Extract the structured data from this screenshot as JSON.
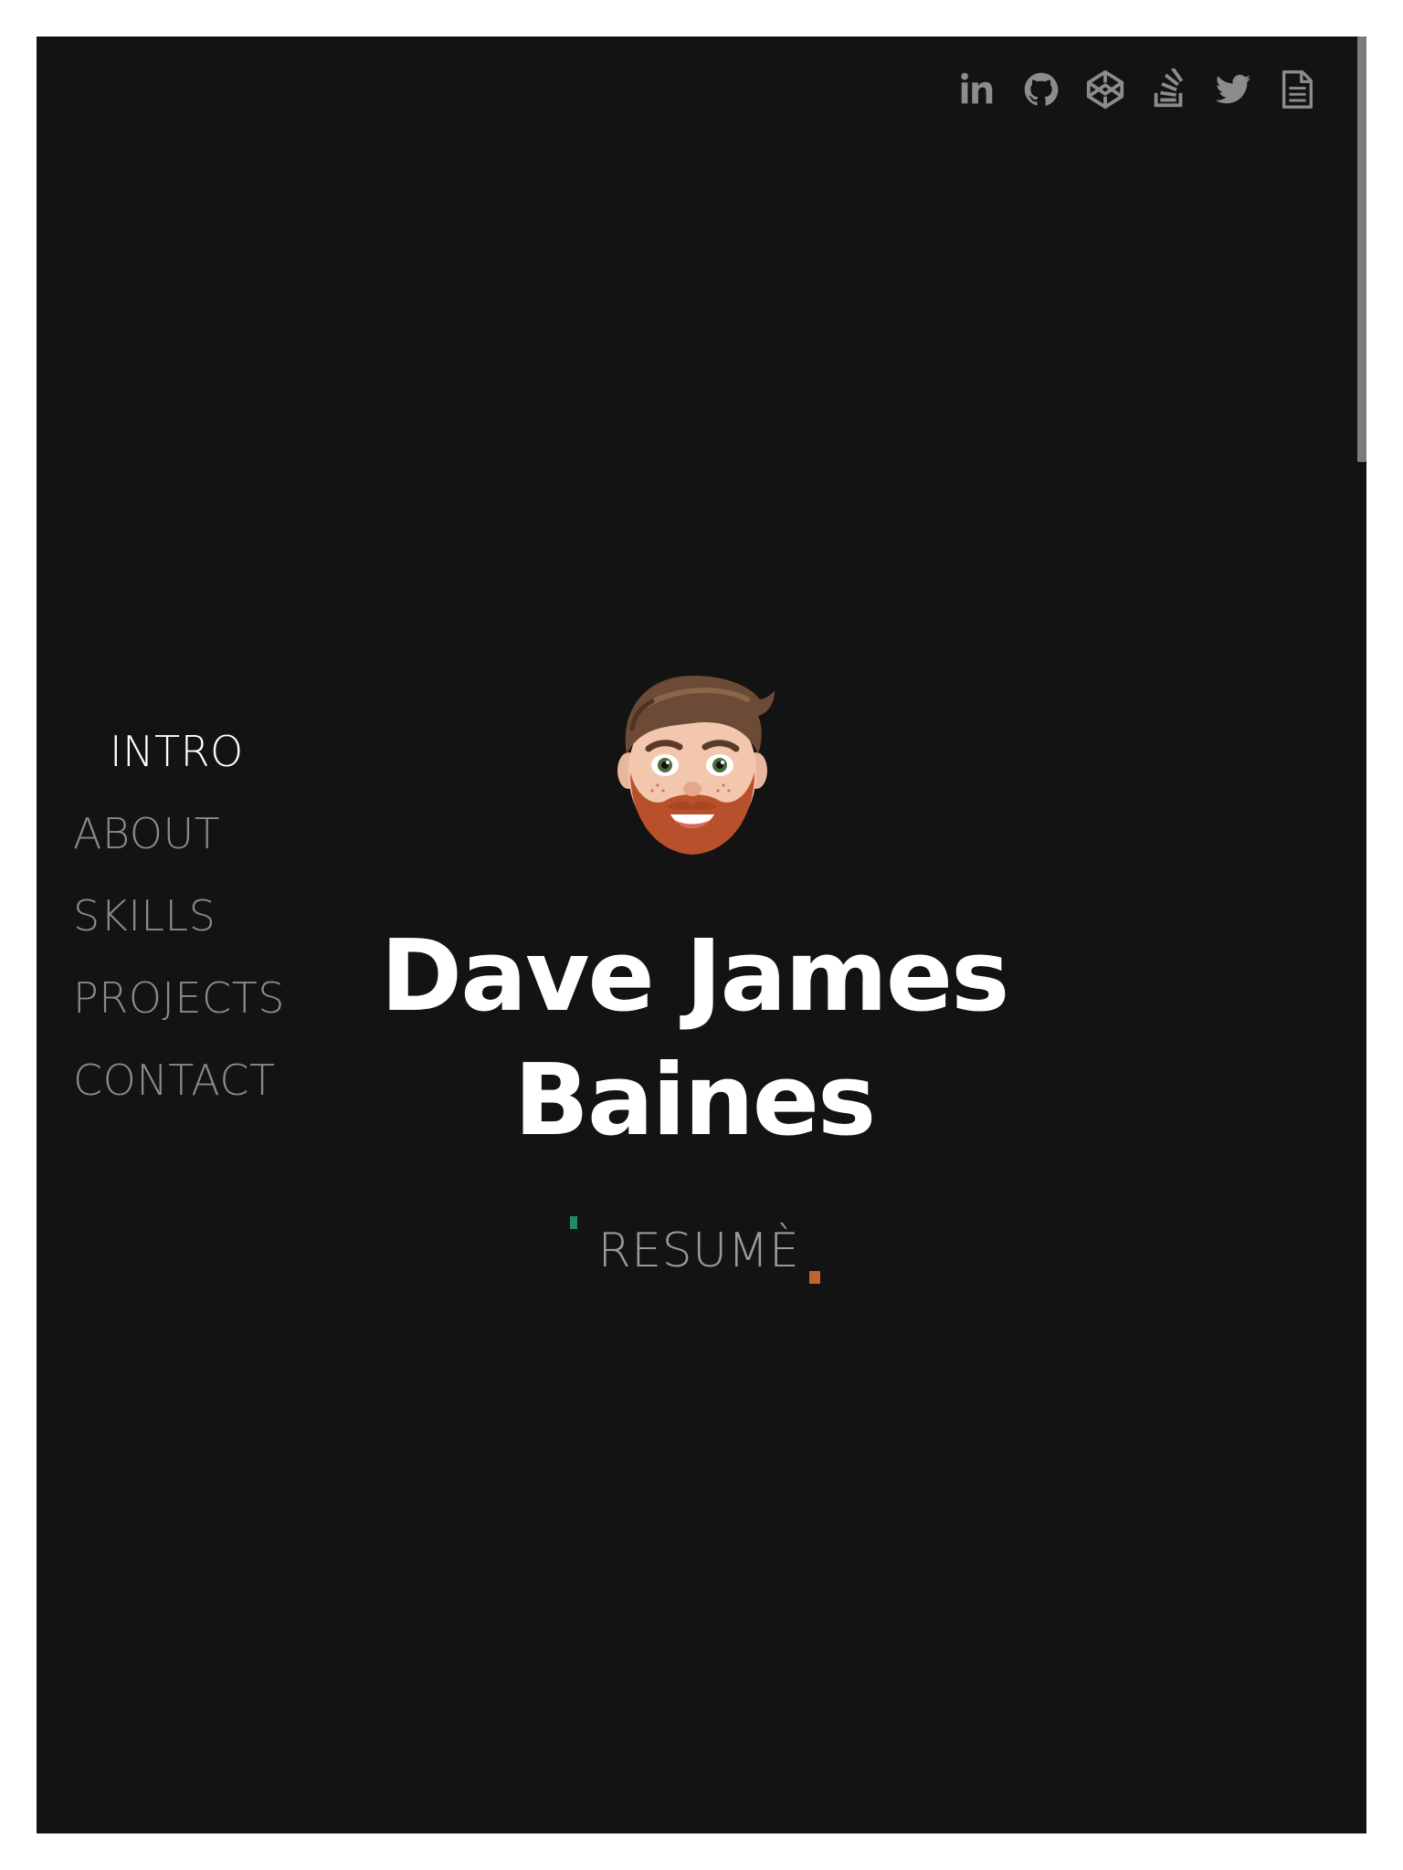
{
  "social": [
    {
      "name": "linkedin-icon",
      "label": "LinkedIn"
    },
    {
      "name": "github-icon",
      "label": "GitHub"
    },
    {
      "name": "codepen-icon",
      "label": "CodePen"
    },
    {
      "name": "stackoverflow-icon",
      "label": "Stack Overflow"
    },
    {
      "name": "twitter-icon",
      "label": "Twitter"
    },
    {
      "name": "document-icon",
      "label": "Document"
    }
  ],
  "nav": {
    "items": [
      {
        "label": "INTRO",
        "active": true
      },
      {
        "label": "ABOUT",
        "active": false
      },
      {
        "label": "SKILLS",
        "active": false
      },
      {
        "label": "PROJECTS",
        "active": false
      },
      {
        "label": "CONTACT",
        "active": false
      }
    ]
  },
  "hero": {
    "name_line1": "Dave James",
    "name_line2": "Baines",
    "resume_label": "RESUMÈ"
  },
  "colors": {
    "background": "#131313",
    "text_primary": "#ffffff",
    "text_muted": "#8a8a8a",
    "accent_green": "#1f8a6a",
    "accent_orange": "#c0632d"
  }
}
